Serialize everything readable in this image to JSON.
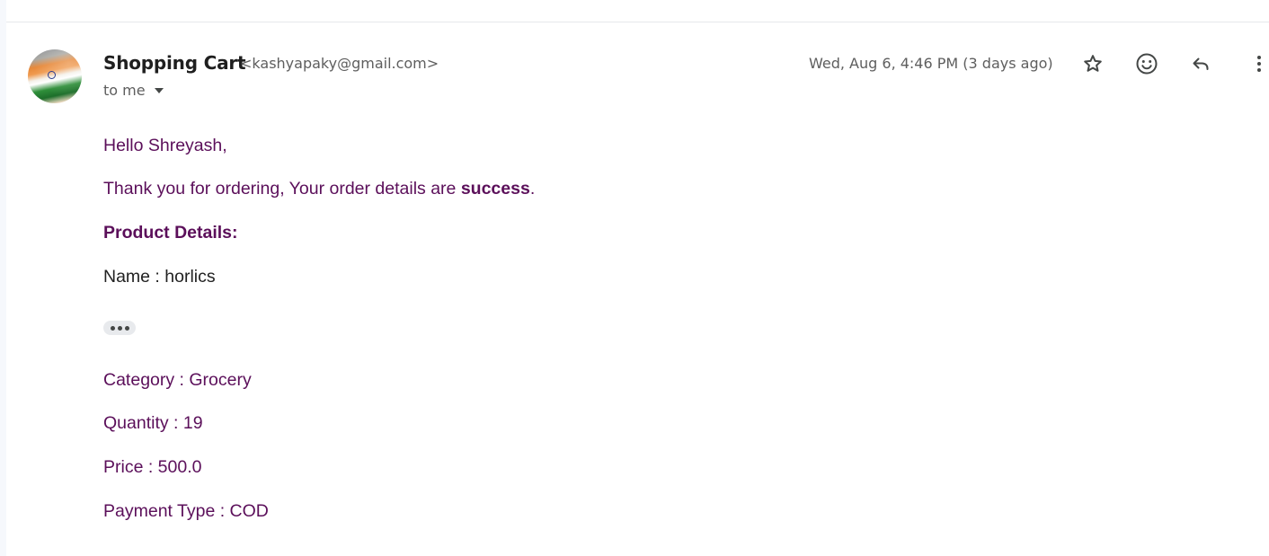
{
  "email": {
    "sender": {
      "name": "Shopping Cart",
      "email": "<kashyapaky@gmail.com>"
    },
    "recipient_label": "to me",
    "timestamp": "Wed, Aug 6, 4:46 PM (3 days ago)",
    "actions": {
      "star_icon": "star-icon",
      "emoji_icon": "emoji-reaction-icon",
      "reply_icon": "reply-icon",
      "more_icon": "more-vert-icon"
    },
    "body": {
      "greeting": "Hello Shreyash,",
      "thanks_prefix": "Thank you for ordering, Your order details are ",
      "thanks_status": "success",
      "thanks_suffix": ".",
      "product_heading": "Product Details:",
      "name_line": "Name : horlics",
      "category_line": "Category : Grocery",
      "quantity_line": "Quantity : 19",
      "price_line": "Price : 500.0",
      "payment_line": "Payment Type : COD"
    }
  },
  "colors": {
    "body_text": "#5b0f5a",
    "meta_text": "#5e5e5e",
    "heading_text": "#1f1f1f"
  }
}
